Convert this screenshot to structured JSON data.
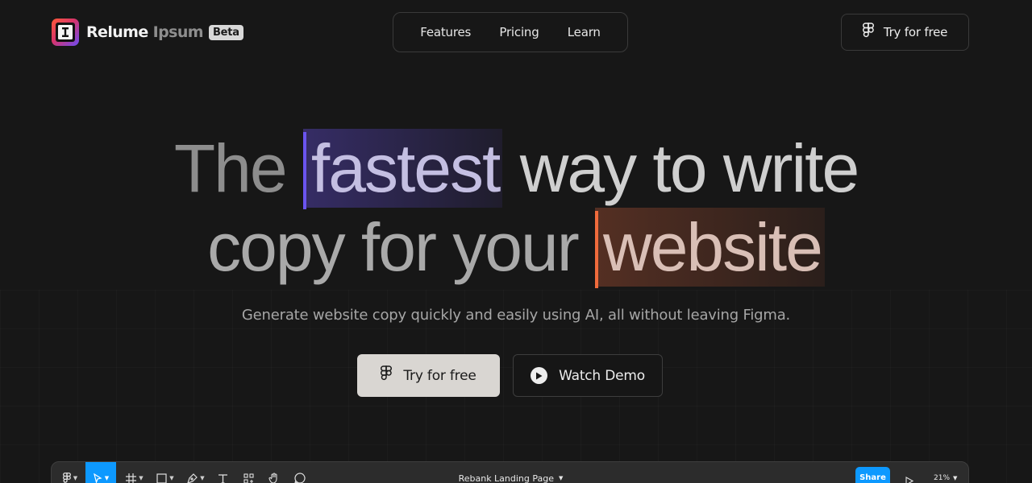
{
  "brand": {
    "name_main": "Relume",
    "name_dim": "Ipsum",
    "badge": "Beta"
  },
  "nav": {
    "items": [
      "Features",
      "Pricing",
      "Learn"
    ]
  },
  "header_cta": {
    "label": "Try for free"
  },
  "hero": {
    "line1": {
      "w1": "The",
      "highlight": "fastest",
      "rest": "way to write"
    },
    "line2": {
      "w1": "copy for your",
      "highlight": "website"
    },
    "subtitle": "Generate website copy quickly and easily using AI, all without leaving Figma.",
    "primary_cta": "Try for free",
    "secondary_cta": "Watch Demo"
  },
  "toolbar": {
    "document_title": "Rebank Landing Page",
    "share_label": "Share",
    "zoom": "21%",
    "tools": [
      "figma-menu-icon",
      "move-icon",
      "frame-icon",
      "rectangle-icon",
      "pen-icon",
      "text-icon",
      "components-icon",
      "hand-icon",
      "comment-icon"
    ]
  },
  "colors": {
    "background": "#171717",
    "highlight_purple": "#6a54f0",
    "highlight_orange": "#ef6b3c",
    "figma_blue": "#0d99ff"
  }
}
